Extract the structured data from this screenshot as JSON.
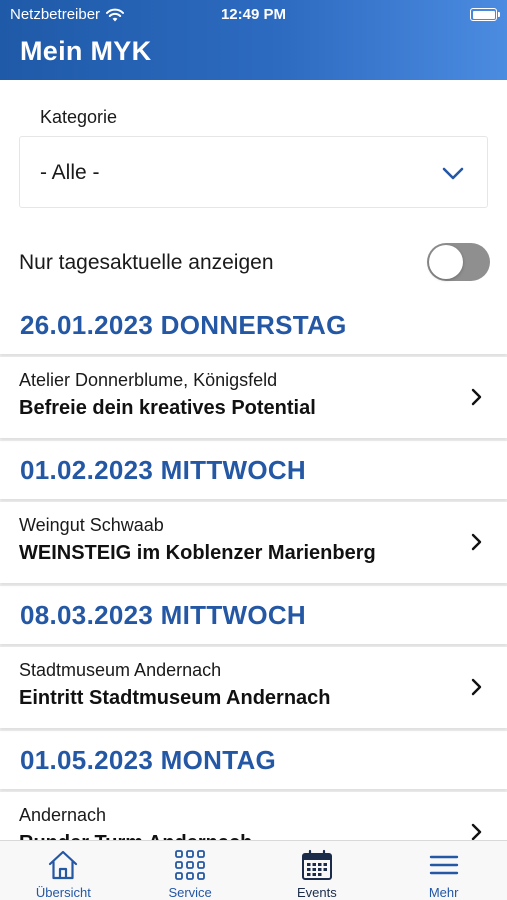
{
  "status_bar": {
    "carrier": "Netzbetreiber",
    "time": "12:49 PM"
  },
  "app": {
    "title": "Mein MYK"
  },
  "filter": {
    "label": "Kategorie",
    "selected": "- Alle -"
  },
  "toggle": {
    "label": "Nur tagesaktuelle anzeigen",
    "on": false
  },
  "groups": [
    {
      "date": "26.01.2023 DONNERSTAG",
      "location": "Atelier Donnerblume, Königsfeld",
      "title": "Befreie dein kreatives Potential"
    },
    {
      "date": "01.02.2023 MITTWOCH",
      "location": "Weingut Schwaab",
      "title": "WEINSTEIG im Koblenzer Marienberg"
    },
    {
      "date": "08.03.2023 MITTWOCH",
      "location": "Stadtmuseum Andernach",
      "title": "Eintritt Stadtmuseum Andernach"
    },
    {
      "date": "01.05.2023 MONTAG",
      "location": "Andernach",
      "title": "Runder Turm Andernach"
    }
  ],
  "tabs": [
    {
      "label": "Übersicht",
      "icon": "home-icon"
    },
    {
      "label": "Service",
      "icon": "grid-icon"
    },
    {
      "label": "Events",
      "icon": "calendar-icon",
      "active": true
    },
    {
      "label": "Mehr",
      "icon": "menu-icon"
    }
  ],
  "colors": {
    "accent": "#2457a4",
    "header_start": "#1f5aa8",
    "header_end": "#4b8be0"
  }
}
